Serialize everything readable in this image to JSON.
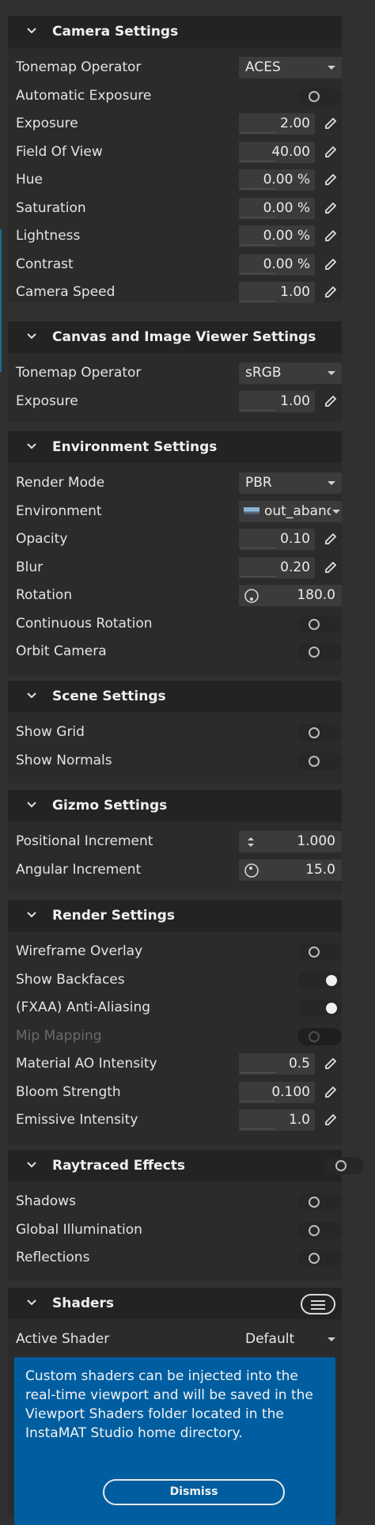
{
  "sections": {
    "camera": {
      "title": "Camera Settings",
      "tonemap": {
        "label": "Tonemap Operator",
        "value": "ACES"
      },
      "auto_exposure": {
        "label": "Automatic Exposure",
        "on": false
      },
      "exposure": {
        "label": "Exposure",
        "value": "2.00"
      },
      "fov": {
        "label": "Field Of View",
        "value": "40.00"
      },
      "hue": {
        "label": "Hue",
        "value": "0.00 %"
      },
      "saturation": {
        "label": "Saturation",
        "value": "0.00 %"
      },
      "lightness": {
        "label": "Lightness",
        "value": "0.00 %"
      },
      "contrast": {
        "label": "Contrast",
        "value": "0.00 %"
      },
      "speed": {
        "label": "Camera Speed",
        "value": "1.00"
      }
    },
    "canvas": {
      "title": "Canvas and Image Viewer Settings",
      "tonemap": {
        "label": "Tonemap Operator",
        "value": "sRGB"
      },
      "exposure": {
        "label": "Exposure",
        "value": "1.00"
      }
    },
    "environment": {
      "title": "Environment Settings",
      "render_mode": {
        "label": "Render Mode",
        "value": "PBR"
      },
      "environment": {
        "label": "Environment",
        "value": "out_abandoned"
      },
      "opacity": {
        "label": "Opacity",
        "value": "0.10"
      },
      "blur": {
        "label": "Blur",
        "value": "0.20"
      },
      "rotation": {
        "label": "Rotation",
        "value": "180.0"
      },
      "continuous_rotation": {
        "label": "Continuous Rotation",
        "on": false
      },
      "orbit_camera": {
        "label": "Orbit Camera",
        "on": false
      }
    },
    "scene": {
      "title": "Scene Settings",
      "show_grid": {
        "label": "Show Grid",
        "on": false
      },
      "show_normals": {
        "label": "Show Normals",
        "on": false
      }
    },
    "gizmo": {
      "title": "Gizmo Settings",
      "positional": {
        "label": "Positional Increment",
        "value": "1.000"
      },
      "angular": {
        "label": "Angular Increment",
        "value": "15.0"
      }
    },
    "render": {
      "title": "Render Settings",
      "wireframe": {
        "label": "Wireframe Overlay",
        "on": false
      },
      "backfaces": {
        "label": "Show Backfaces",
        "on": true
      },
      "fxaa": {
        "label": "(FXAA) Anti-Aliasing",
        "on": true
      },
      "mip": {
        "label": "Mip Mapping",
        "on": false,
        "disabled": true
      },
      "ao": {
        "label": "Material AO Intensity",
        "value": "0.5"
      },
      "bloom": {
        "label": "Bloom Strength",
        "value": "0.100"
      },
      "emissive": {
        "label": "Emissive Intensity",
        "value": "1.0"
      }
    },
    "raytraced": {
      "title": "Raytraced Effects",
      "enabled": false,
      "shadows": {
        "label": "Shadows",
        "on": false
      },
      "gi": {
        "label": "Global Illumination",
        "on": false
      },
      "reflections": {
        "label": "Reflections",
        "on": false
      }
    },
    "shaders": {
      "title": "Shaders",
      "active": {
        "label": "Active Shader",
        "value": "Default"
      },
      "info": "Custom shaders can be injected into the real-time viewport and will be saved in the Viewport Shaders folder located in the InstaMAT Studio home directory.",
      "dismiss": "Dismiss"
    }
  },
  "colors": {
    "background": "#303030",
    "header": "#232323",
    "field": "#3b3b3b",
    "info_box": "#005ea0",
    "text": "#e4e4e4"
  },
  "icons": [
    "chevron-down-icon",
    "pencil-icon",
    "dial-icon",
    "spin-arrows-icon",
    "hamburger-menu-icon"
  ]
}
